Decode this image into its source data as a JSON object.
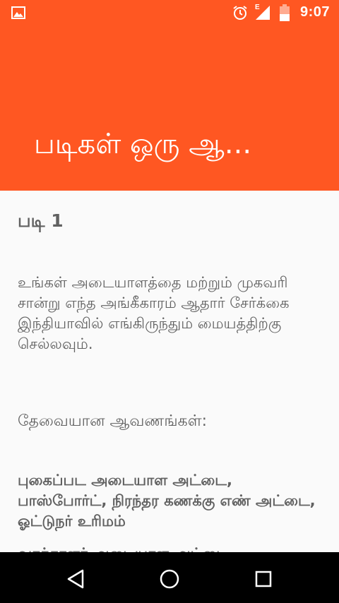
{
  "status_bar": {
    "time": "9:07",
    "network": "E",
    "icons": [
      "image-icon",
      "alarm-icon",
      "signal-icon",
      "battery-icon"
    ]
  },
  "app_bar": {
    "title": "படிகள் ஒரு ஆ..."
  },
  "content": {
    "step_heading": "படி 1",
    "paragraph1": "உங்கள் அடையாளத்தை மற்றும் முகவரி சான்று எந்த அங்கீகாரம் ஆதார் சேர்க்கை இந்தியாவில் எங்கிருந்தும் மையத்திற்கு செல்லவும்.",
    "docs_heading": "தேவையான ஆவணங்கள்:",
    "docs_list": "புகைப்பட அடையாள அட்டை, பாஸ்போர்ட், நிரந்தர கணக்கு எண் அட்டை, ஓட்டுநர் உரிமம்",
    "partial_line": "வாக்காளர் அடையாள அட்டை"
  },
  "nav_bar": {
    "buttons": [
      "back-icon",
      "home-icon",
      "recents-icon"
    ]
  },
  "colors": {
    "accent": "#ff5722",
    "text": "#616161",
    "background": "#fafafa"
  }
}
